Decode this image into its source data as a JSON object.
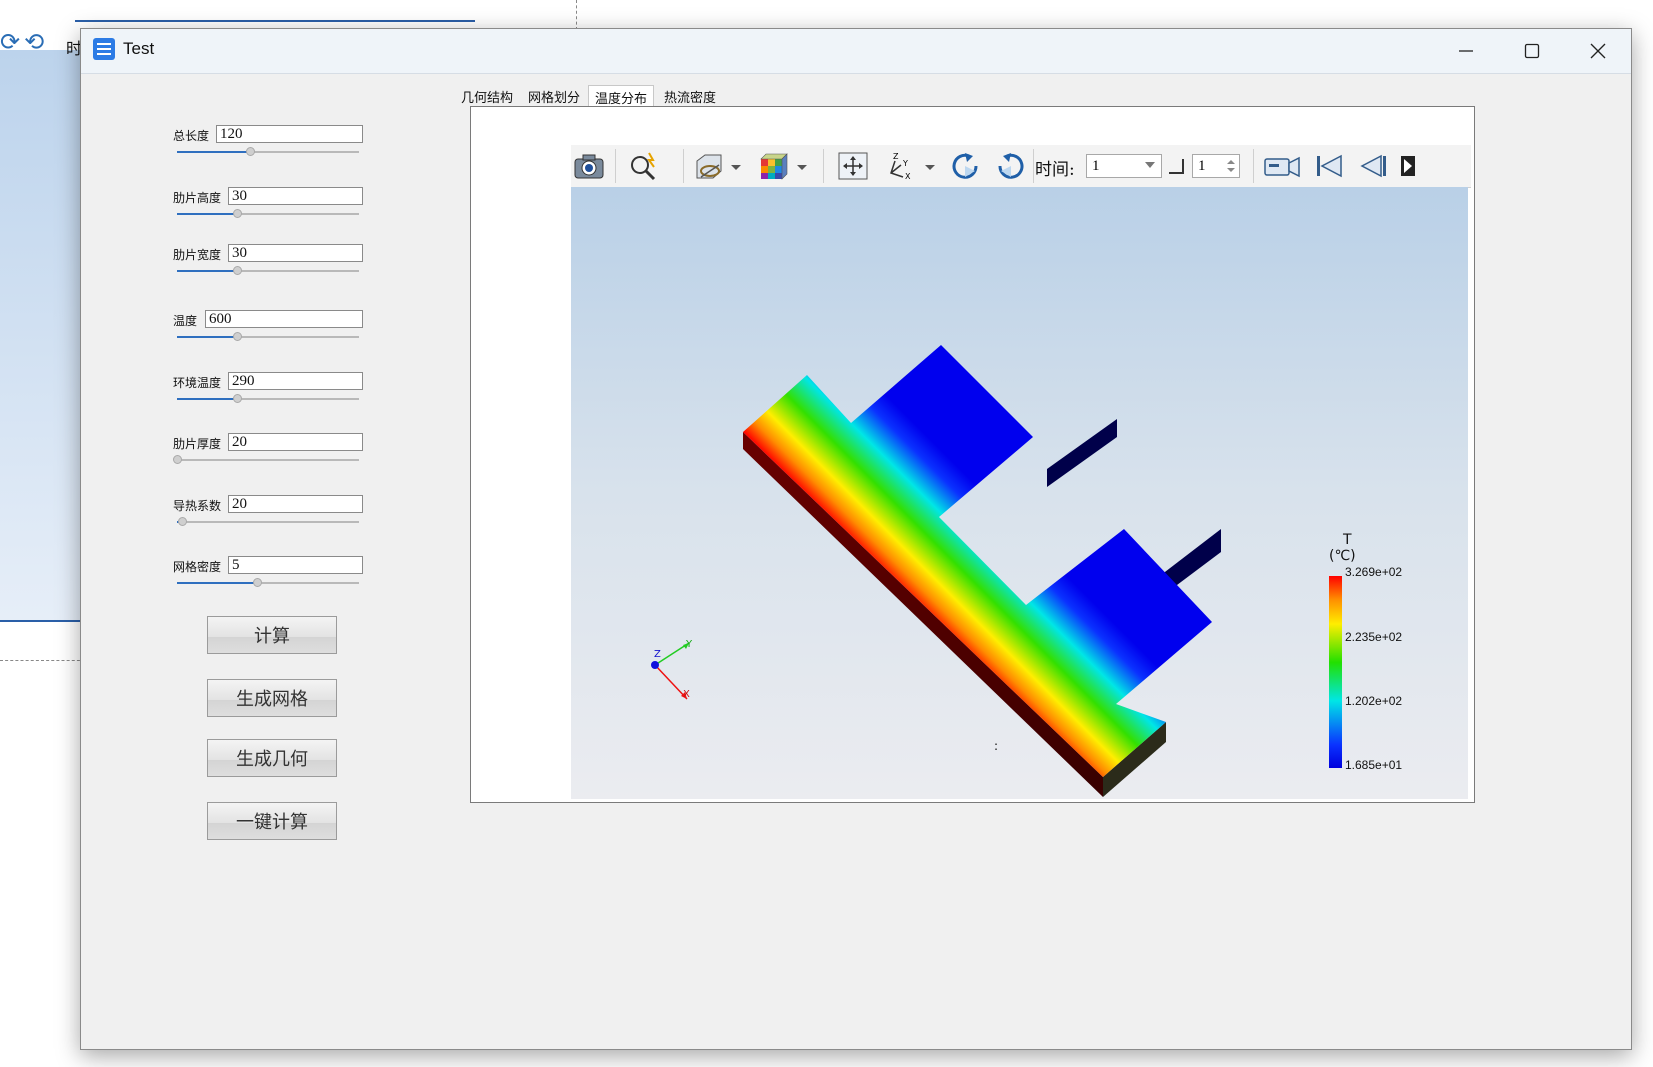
{
  "window": {
    "title": "Test"
  },
  "background_window": {
    "text": "时"
  },
  "controls": {
    "fields": [
      {
        "label": "总长度",
        "value": "120",
        "slider": 0.4
      },
      {
        "label": "肋片高度",
        "value": "30",
        "slider": 0.33
      },
      {
        "label": "肋片宽度",
        "value": "30",
        "slider": 0.33
      },
      {
        "label": "温度",
        "value": "600",
        "slider": 0.33
      },
      {
        "label": "环境温度",
        "value": "290",
        "slider": 0.33
      },
      {
        "label": "肋片厚度",
        "value": "20",
        "slider": 0.0
      },
      {
        "label": "导热系数",
        "value": "20",
        "slider": 0.03
      },
      {
        "label": "网格密度",
        "value": "5",
        "slider": 0.44
      }
    ],
    "buttons": [
      "计算",
      "生成网格",
      "生成几何",
      "一键计算"
    ]
  },
  "tabs": [
    {
      "label": "几何结构",
      "active": false
    },
    {
      "label": "网格划分",
      "active": false
    },
    {
      "label": "温度分布",
      "active": true
    },
    {
      "label": "热流密度",
      "active": false
    }
  ],
  "toolbar": {
    "time_label": "时间:",
    "time_value": "1",
    "step_value": "1"
  },
  "legend": {
    "title_line1": "T",
    "title_line2": "(℃)",
    "ticks": [
      "3.269e+02",
      "2.235e+02",
      "1.202e+02",
      "1.685e+01"
    ]
  },
  "axes_triad": {
    "x": "X",
    "y": "Y",
    "z": "Z"
  },
  "viewport_marker": ":"
}
